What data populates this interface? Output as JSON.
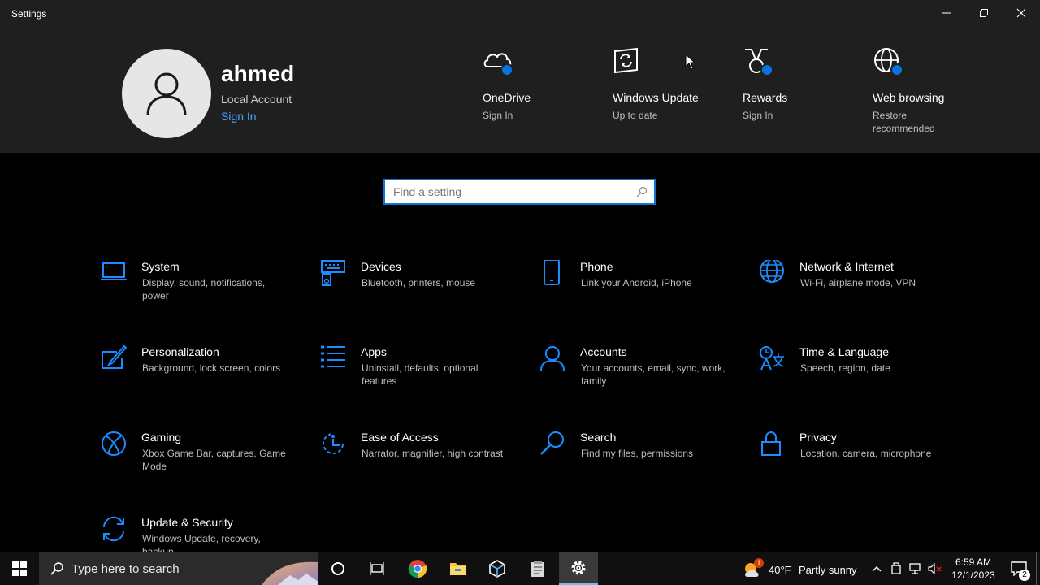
{
  "window": {
    "title": "Settings"
  },
  "header": {
    "username": "ahmed",
    "account_type": "Local Account",
    "signin": "Sign In",
    "items": [
      {
        "label": "OneDrive",
        "sub": "Sign In",
        "icon": "onedrive-icon"
      },
      {
        "label": "Windows Update",
        "sub": "Up to date",
        "icon": "windows-update-icon"
      },
      {
        "label": "Rewards",
        "sub": "Sign In",
        "icon": "rewards-icon"
      },
      {
        "label": "Web browsing",
        "sub": "Restore recommended",
        "icon": "web-browsing-icon"
      }
    ]
  },
  "search": {
    "placeholder": "Find a setting"
  },
  "tiles": [
    {
      "label": "System",
      "sub": "Display, sound, notifications, power"
    },
    {
      "label": "Devices",
      "sub": "Bluetooth, printers, mouse"
    },
    {
      "label": "Phone",
      "sub": "Link your Android, iPhone"
    },
    {
      "label": "Network & Internet",
      "sub": "Wi-Fi, airplane mode, VPN"
    },
    {
      "label": "Personalization",
      "sub": "Background, lock screen, colors"
    },
    {
      "label": "Apps",
      "sub": "Uninstall, defaults, optional features"
    },
    {
      "label": "Accounts",
      "sub": "Your accounts, email, sync, work, family"
    },
    {
      "label": "Time & Language",
      "sub": "Speech, region, date"
    },
    {
      "label": "Gaming",
      "sub": "Xbox Game Bar, captures, Game Mode"
    },
    {
      "label": "Ease of Access",
      "sub": "Narrator, magnifier, high contrast"
    },
    {
      "label": "Search",
      "sub": "Find my files, permissions"
    },
    {
      "label": "Privacy",
      "sub": "Location, camera, microphone"
    },
    {
      "label": "Update & Security",
      "sub": "Windows Update, recovery, backup"
    }
  ],
  "taskbar": {
    "search_text": "Type here to search",
    "weather_temp": "40°F",
    "weather_desc": "Partly sunny",
    "weather_badge": "1",
    "time": "6:59 AM",
    "date": "12/1/2023",
    "notification_count": "2"
  },
  "colors": {
    "accent": "#0a74da",
    "header_bg": "#1f1f1f",
    "icon_blue": "#1a8cff"
  }
}
